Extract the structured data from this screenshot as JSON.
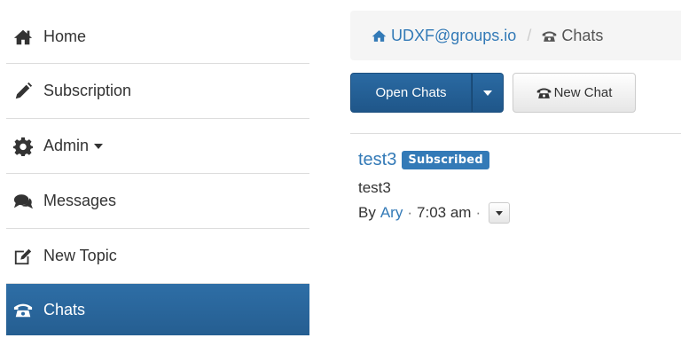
{
  "sidebar": {
    "items": [
      {
        "label": "Home",
        "icon": "home-icon"
      },
      {
        "label": "Subscription",
        "icon": "pencil-icon"
      },
      {
        "label": "Admin",
        "icon": "gear-icon"
      },
      {
        "label": "Messages",
        "icon": "comments-icon"
      },
      {
        "label": "New Topic",
        "icon": "edit-icon"
      },
      {
        "label": "Chats",
        "icon": "phone-icon",
        "active": true
      }
    ]
  },
  "breadcrumb": {
    "group": "UDXF@groups.io",
    "separator": "/",
    "current": "Chats"
  },
  "toolbar": {
    "open_chats_label": "Open Chats",
    "new_chat_label": "New Chat"
  },
  "chat": {
    "title": "test3",
    "badge": "Subscribed",
    "body": "test3",
    "by_label": "By",
    "author": "Ary",
    "separator": "·",
    "time": "7:03 am"
  },
  "colors": {
    "accent": "#337ab7",
    "active_nav": "#2a6aa3",
    "breadcrumb_bg": "#f5f5f5"
  }
}
